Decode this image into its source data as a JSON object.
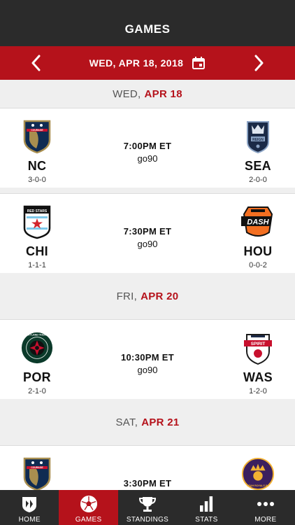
{
  "header": {
    "title": "GAMES"
  },
  "datebar": {
    "date": "WED, APR 18, 2018"
  },
  "days": [
    {
      "dow": "WED,",
      "md": "APR 18"
    },
    {
      "dow": "FRI,",
      "md": "APR 20"
    },
    {
      "dow": "SAT,",
      "md": "APR 21"
    }
  ],
  "games": [
    {
      "home": {
        "abbr": "NC",
        "record": "3-0-0",
        "logo_text": "COURAGE"
      },
      "away": {
        "abbr": "SEA",
        "record": "2-0-0",
        "logo_text": "REIGN"
      },
      "time": "7:00PM ET",
      "network": "go90"
    },
    {
      "home": {
        "abbr": "CHI",
        "record": "1-1-1",
        "logo_text": "RED STARS"
      },
      "away": {
        "abbr": "HOU",
        "record": "0-0-2",
        "logo_text": "DASH"
      },
      "time": "7:30PM ET",
      "network": "go90"
    },
    {
      "home": {
        "abbr": "POR",
        "record": "2-1-0",
        "logo_text": "PORTLAND THORNS"
      },
      "away": {
        "abbr": "WAS",
        "record": "1-2-0",
        "logo_text": "SPIRIT"
      },
      "time": "10:30PM ET",
      "network": "go90"
    },
    {
      "home": {
        "abbr": "",
        "record": "",
        "logo_text": "COURAGE"
      },
      "away": {
        "abbr": "",
        "record": "",
        "logo_text": "UTAH ROYALS FC"
      },
      "time": "3:30PM ET",
      "network": ""
    }
  ],
  "tabs": [
    {
      "label": "HOME",
      "icon": "league-logo-icon"
    },
    {
      "label": "GAMES",
      "icon": "soccer-ball-icon"
    },
    {
      "label": "STANDINGS",
      "icon": "trophy-icon"
    },
    {
      "label": "STATS",
      "icon": "bar-chart-icon"
    },
    {
      "label": "MORE",
      "icon": "more-dots-icon"
    }
  ],
  "colors": {
    "accent": "#b5121b",
    "dark": "#2b2b2b",
    "background": "#efefef"
  }
}
